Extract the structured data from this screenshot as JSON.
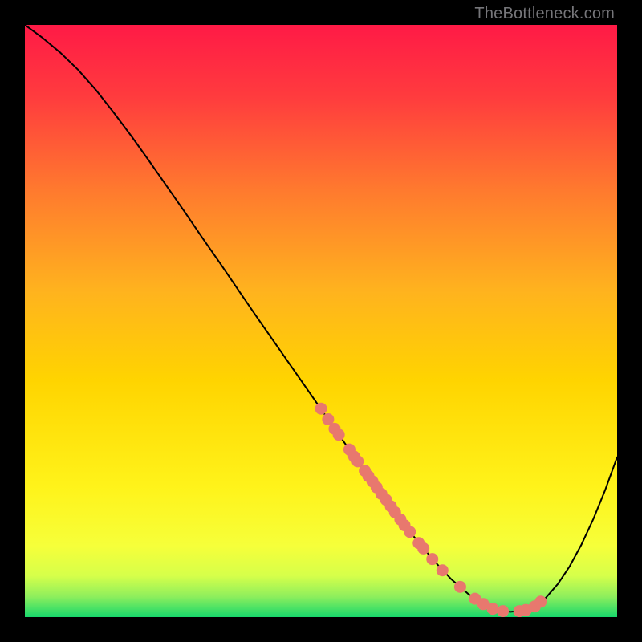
{
  "watermark": "TheBottleneck.com",
  "chart_data": {
    "type": "line",
    "title": "",
    "xlabel": "",
    "ylabel": "",
    "xlim": [
      0,
      100
    ],
    "ylim": [
      0,
      100
    ],
    "gradient_colors": {
      "top": "#ff1a46",
      "mid_upper": "#ffd400",
      "mid_lower": "#f6ff3a",
      "bottom": "#17d86c"
    },
    "series": [
      {
        "name": "curve",
        "type": "line",
        "points": [
          {
            "x": 0.0,
            "y": 100.0
          },
          {
            "x": 3.0,
            "y": 97.8
          },
          {
            "x": 6.0,
            "y": 95.3
          },
          {
            "x": 9.0,
            "y": 92.4
          },
          {
            "x": 12.0,
            "y": 89.0
          },
          {
            "x": 15.0,
            "y": 85.2
          },
          {
            "x": 18.0,
            "y": 81.2
          },
          {
            "x": 21.0,
            "y": 77.0
          },
          {
            "x": 24.0,
            "y": 72.7
          },
          {
            "x": 27.0,
            "y": 68.4
          },
          {
            "x": 30.0,
            "y": 64.0
          },
          {
            "x": 33.0,
            "y": 59.7
          },
          {
            "x": 36.0,
            "y": 55.3
          },
          {
            "x": 39.0,
            "y": 50.9
          },
          {
            "x": 42.0,
            "y": 46.6
          },
          {
            "x": 45.0,
            "y": 42.3
          },
          {
            "x": 48.0,
            "y": 38.0
          },
          {
            "x": 51.0,
            "y": 33.7
          },
          {
            "x": 54.0,
            "y": 29.4
          },
          {
            "x": 57.0,
            "y": 25.2
          },
          {
            "x": 60.0,
            "y": 21.1
          },
          {
            "x": 63.0,
            "y": 17.0
          },
          {
            "x": 66.0,
            "y": 13.2
          },
          {
            "x": 69.0,
            "y": 9.6
          },
          {
            "x": 72.0,
            "y": 6.4
          },
          {
            "x": 75.0,
            "y": 3.8
          },
          {
            "x": 78.0,
            "y": 1.9
          },
          {
            "x": 80.0,
            "y": 1.1
          },
          {
            "x": 82.0,
            "y": 0.9
          },
          {
            "x": 84.0,
            "y": 1.1
          },
          {
            "x": 86.0,
            "y": 1.8
          },
          {
            "x": 88.0,
            "y": 3.3
          },
          {
            "x": 90.0,
            "y": 5.6
          },
          {
            "x": 92.0,
            "y": 8.6
          },
          {
            "x": 94.0,
            "y": 12.3
          },
          {
            "x": 96.0,
            "y": 16.6
          },
          {
            "x": 98.0,
            "y": 21.5
          },
          {
            "x": 100.0,
            "y": 27.0
          }
        ]
      },
      {
        "name": "dots",
        "type": "scatter",
        "color": "#e8786e",
        "points": [
          {
            "x": 50.0,
            "y": 35.2
          },
          {
            "x": 51.2,
            "y": 33.4
          },
          {
            "x": 52.3,
            "y": 31.8
          },
          {
            "x": 53.0,
            "y": 30.8
          },
          {
            "x": 54.8,
            "y": 28.3
          },
          {
            "x": 55.6,
            "y": 27.1
          },
          {
            "x": 56.2,
            "y": 26.3
          },
          {
            "x": 57.4,
            "y": 24.7
          },
          {
            "x": 58.0,
            "y": 23.8
          },
          {
            "x": 58.7,
            "y": 22.9
          },
          {
            "x": 59.4,
            "y": 21.9
          },
          {
            "x": 60.2,
            "y": 20.8
          },
          {
            "x": 61.0,
            "y": 19.8
          },
          {
            "x": 61.8,
            "y": 18.7
          },
          {
            "x": 62.5,
            "y": 17.7
          },
          {
            "x": 63.4,
            "y": 16.5
          },
          {
            "x": 64.1,
            "y": 15.5
          },
          {
            "x": 65.0,
            "y": 14.4
          },
          {
            "x": 66.5,
            "y": 12.5
          },
          {
            "x": 67.3,
            "y": 11.6
          },
          {
            "x": 68.8,
            "y": 9.8
          },
          {
            "x": 70.5,
            "y": 7.9
          },
          {
            "x": 73.5,
            "y": 5.1
          },
          {
            "x": 76.0,
            "y": 3.1
          },
          {
            "x": 77.4,
            "y": 2.2
          },
          {
            "x": 79.0,
            "y": 1.4
          },
          {
            "x": 80.7,
            "y": 1.0
          },
          {
            "x": 83.5,
            "y": 1.0
          },
          {
            "x": 84.6,
            "y": 1.2
          },
          {
            "x": 86.1,
            "y": 1.8
          },
          {
            "x": 87.1,
            "y": 2.6
          }
        ]
      }
    ]
  }
}
